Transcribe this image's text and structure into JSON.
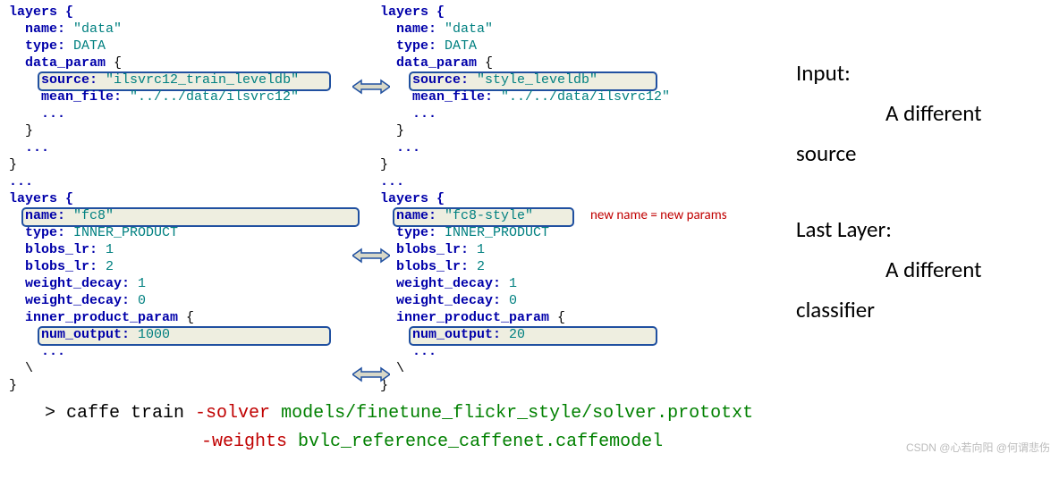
{
  "left": {
    "l0": "layers {",
    "l1": "  name: ",
    "l1v": "\"data\"",
    "l2": "  type: ",
    "l2v": "DATA",
    "l3": "  data_param ",
    "l3b": "{",
    "l4k": "source: ",
    "l4v": "\"ilsvrc12_train_leveldb\"",
    "l5": "    mean_file: ",
    "l5v": "\"../../data/ilsvrc12\"",
    "l6": "    ...",
    "l7": "  }",
    "l8": "  ...",
    "l9": "}",
    "l10": "...",
    "l11": "layers {",
    "l12k": "name: ",
    "l12v": "\"fc8\"",
    "l13": "  type: ",
    "l13v": "INNER_PRODUCT",
    "l14": "  blobs_lr: ",
    "l14v": "1",
    "l15": "  blobs_lr: ",
    "l15v": "2",
    "l16": "  weight_decay: ",
    "l16v": "1",
    "l17": "  weight_decay: ",
    "l17v": "0",
    "l18": "  inner_product_param ",
    "l18b": "{",
    "l19k": "num_output: ",
    "l19v": "1000",
    "l20": "    ...",
    "l21": "  \\",
    "l22": "}"
  },
  "right": {
    "l0": "layers {",
    "l1": "  name: ",
    "l1v": "\"data\"",
    "l2": "  type: ",
    "l2v": "DATA",
    "l3": "  data_param ",
    "l3b": "{",
    "l4k": "source: ",
    "l4v": "\"style_leveldb\"",
    "l5": "    mean_file: ",
    "l5v": "\"../../data/ilsvrc12\"",
    "l6": "    ...",
    "l7": "  }",
    "l8": "  ...",
    "l9": "}",
    "l10": "...",
    "l11": "layers {",
    "l12k": "name: ",
    "l12v": "\"fc8-style\"",
    "l13": "  type: ",
    "l13v": "INNER_PRODUCT",
    "l14": "  blobs_lr: ",
    "l14v": "1",
    "l15": "  blobs_lr: ",
    "l15v": "2",
    "l16": "  weight_decay: ",
    "l16v": "1",
    "l17": "  weight_decay: ",
    "l17v": "0",
    "l18": "  inner_product_param ",
    "l18b": "{",
    "l19k": "num_output: ",
    "l19v": "20",
    "l20": "    ...",
    "l21": "  \\",
    "l22": "}"
  },
  "annotation": "new name = new params",
  "explain": {
    "input_title": "Input:",
    "input_sub": "A different",
    "input_sub2": "source",
    "last_title": "Last Layer:",
    "last_sub": "A different",
    "last_sub2": "classifier"
  },
  "command": {
    "prompt": "> ",
    "caffe": "caffe train ",
    "solver_flag": "-solver ",
    "solver_val": "models/finetune_flickr_style/solver.prototxt",
    "weights_flag": "-weights ",
    "weights_val": "bvlc_reference_caffenet.caffemodel"
  },
  "watermark": "CSDN @心若向阳 @何谓悲伤"
}
